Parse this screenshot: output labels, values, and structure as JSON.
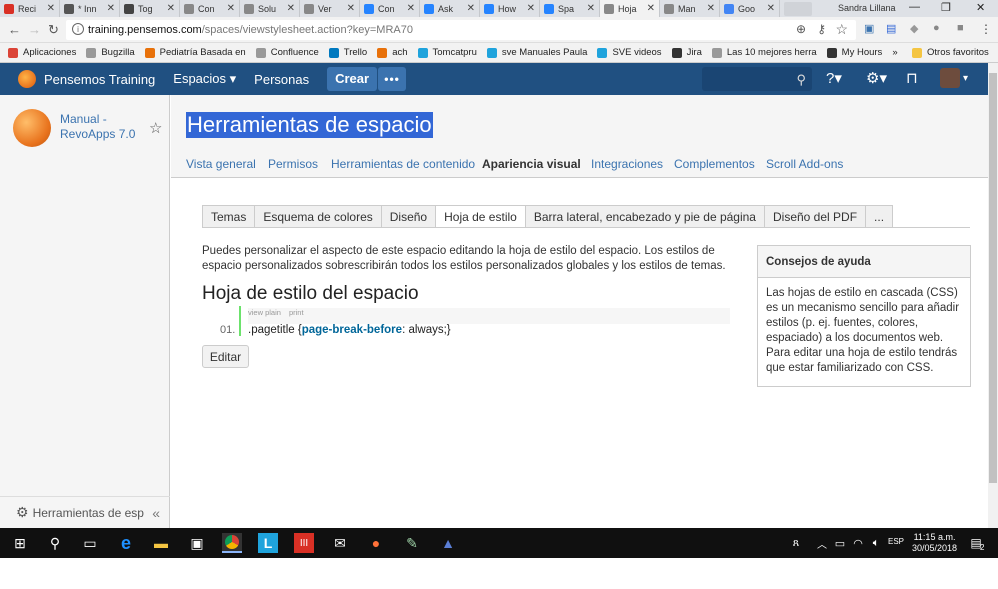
{
  "browser": {
    "tabs": [
      {
        "label": "Reci",
        "color": "#d93025"
      },
      {
        "label": "* Inn",
        "color": "#555555"
      },
      {
        "label": "Tog",
        "color": "#444444"
      },
      {
        "label": "Con",
        "color": "#888888"
      },
      {
        "label": "Solu",
        "color": "#888888"
      },
      {
        "label": "Ver",
        "color": "#888888"
      },
      {
        "label": "Con",
        "color": "#2684ff"
      },
      {
        "label": "Ask",
        "color": "#2684ff"
      },
      {
        "label": "How",
        "color": "#2684ff"
      },
      {
        "label": "Spa",
        "color": "#2684ff"
      },
      {
        "label": "Hoja",
        "color": "#888888"
      },
      {
        "label": "Man",
        "color": "#888888"
      },
      {
        "label": "Goo",
        "color": "#4285f4"
      }
    ],
    "active_tab_index": 10,
    "user_name": "Sandra Lillana",
    "url_host": "training.pensemos.com",
    "url_path": "/spaces/viewstylesheet.action?key=MRA70",
    "bookmarks": [
      {
        "label": "Aplicaciones",
        "color": "#db4437"
      },
      {
        "label": "Bugzilla",
        "color": "#999999"
      },
      {
        "label": "Pediatría Basada en",
        "color": "#e8710a"
      },
      {
        "label": "Confluence",
        "color": "#999999"
      },
      {
        "label": "Trello",
        "color": "#0079bf"
      },
      {
        "label": "ach",
        "color": "#e8710a"
      },
      {
        "label": "Tomcatpru",
        "color": "#1fa3dc"
      },
      {
        "label": "sve Manuales Paula",
        "color": "#1fa3dc"
      },
      {
        "label": "SVE videos",
        "color": "#1fa3dc"
      },
      {
        "label": "Jira",
        "color": "#333333"
      },
      {
        "label": "Las 10 mejores herra",
        "color": "#999999"
      },
      {
        "label": "My Hours",
        "color": "#333333"
      }
    ],
    "bookmarks_more": "»",
    "other_bookmarks": "Otros favoritos"
  },
  "header": {
    "brand": "Pensemos Training",
    "nav": [
      "Espacios ▾",
      "Personas"
    ],
    "create_label": "Crear",
    "more_label": "•••"
  },
  "sidebar": {
    "space_name": "Manual - RevoApps 7.0",
    "tools_label": "Herramientas de esp",
    "collapse_label": "«"
  },
  "page": {
    "title": "Herramientas de espacio",
    "subnav": [
      {
        "label": "Vista general",
        "selected": false
      },
      {
        "label": "Permisos",
        "selected": false
      },
      {
        "label": "Herramientas de contenido",
        "selected": false
      },
      {
        "label": "Apariencia visual",
        "selected": true
      },
      {
        "label": "Integraciones",
        "selected": false
      },
      {
        "label": "Complementos",
        "selected": false
      },
      {
        "label": "Scroll Add-ons",
        "selected": false
      }
    ],
    "tabs": [
      "Temas",
      "Esquema de colores",
      "Diseño",
      "Hoja de estilo",
      "Barra lateral, encabezado y pie de página",
      "Diseño del PDF",
      "..."
    ],
    "active_tab": "Hoja de estilo",
    "description": "Puedes personalizar el aspecto de este espacio editando la hoja de estilo del espacio. Los estilos de espacio personalizados sobrescribirán todos los estilos personalizados globales y los estilos de temas.",
    "stylesheet_heading": "Hoja de estilo del espacio",
    "code": {
      "tools": [
        "view plain",
        "print"
      ],
      "line_number": "01.",
      "selector": ".pagetitle {",
      "property": "page-break-before",
      "value": ": always;}"
    },
    "edit_button": "Editar",
    "help": {
      "title": "Consejos de ayuda",
      "body": "Las hojas de estilo en cascada (CSS) es un mecanismo sencillo para añadir estilos (p. ej. fuentes, colores, espaciado) a los documentos web. Para editar una hoja de estilo tendrás que estar familiarizado con CSS."
    }
  },
  "taskbar": {
    "language": "ESP",
    "time": "11:15 a.m.",
    "date": "30/05/2018",
    "notifications": "2"
  }
}
